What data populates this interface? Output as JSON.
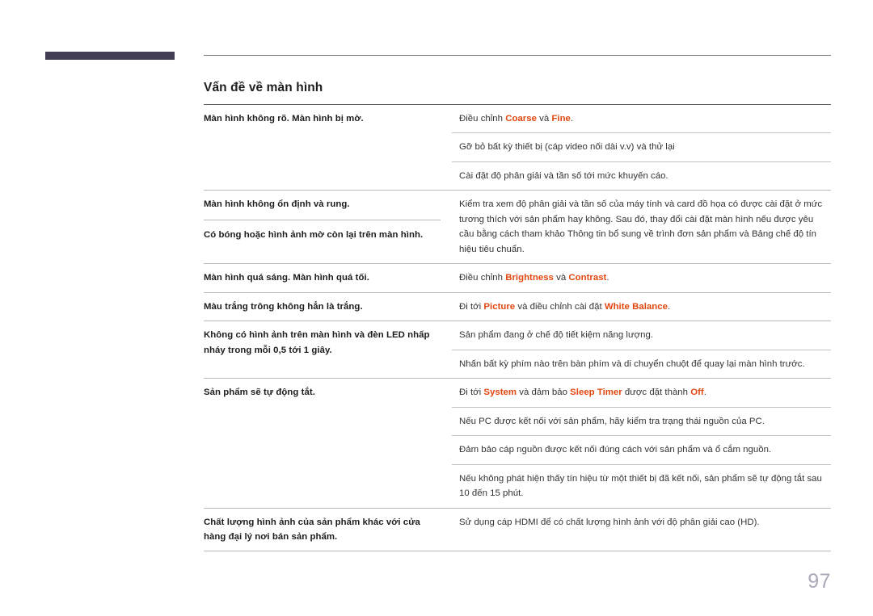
{
  "document": {
    "page_number": "97",
    "heading": "Vấn đề về màn hình",
    "accent_color": "#e2470f",
    "deco_bar_color": "#453d52",
    "page_number_color": "#a9a7b8"
  },
  "table": {
    "rows": [
      {
        "symptom": "Màn hình không rõ. Màn hình bị mờ.",
        "solutions": [
          {
            "parts": [
              {
                "t": "Điều chỉnh ",
                "kw": false
              },
              {
                "t": "Coarse",
                "kw": true
              },
              {
                "t": " và ",
                "kw": false
              },
              {
                "t": "Fine",
                "kw": true
              },
              {
                "t": ".",
                "kw": false
              }
            ]
          },
          {
            "parts": [
              {
                "t": "Gỡ bỏ bất kỳ thiết bị (cáp video nối dài v.v) và thử lại",
                "kw": false
              }
            ]
          },
          {
            "parts": [
              {
                "t": "Cài đặt độ phân giải và tần số tới mức khuyến cáo.",
                "kw": false
              }
            ]
          }
        ]
      },
      {
        "symptom": "Màn hình không ổn định và rung.",
        "symptom2": "Có bóng hoặc hình ảnh mờ còn lại trên màn hình.",
        "solutions": [
          {
            "parts": [
              {
                "t": "Kiểm tra xem độ phân giải và tần số của máy tính và card đồ họa có được cài đặt ở mức tương thích với sản phẩm hay không. Sau đó, thay đổi cài đặt màn hình nếu được yêu cầu bằng cách tham khảo Thông tin bổ sung về trình đơn sản phẩm và Bảng chế độ tín hiệu tiêu chuẩn.",
                "kw": false
              }
            ]
          }
        ]
      },
      {
        "symptom": "Màn hình quá sáng. Màn hình quá tối.",
        "solutions": [
          {
            "parts": [
              {
                "t": "Điều chỉnh ",
                "kw": false
              },
              {
                "t": "Brightness",
                "kw": true
              },
              {
                "t": " và ",
                "kw": false
              },
              {
                "t": "Contrast",
                "kw": true
              },
              {
                "t": ".",
                "kw": false
              }
            ]
          }
        ]
      },
      {
        "symptom": "Màu trắng trông không hẳn là trắng.",
        "solutions": [
          {
            "parts": [
              {
                "t": "Đi tới ",
                "kw": false
              },
              {
                "t": "Picture",
                "kw": true
              },
              {
                "t": " và điều chỉnh cài đặt ",
                "kw": false
              },
              {
                "t": "White Balance",
                "kw": true
              },
              {
                "t": ".",
                "kw": false
              }
            ]
          }
        ]
      },
      {
        "symptom": "Không có hình ảnh trên màn hình và đèn LED nhấp nháy trong mỗi 0,5 tới 1 giây.",
        "solutions": [
          {
            "parts": [
              {
                "t": "Sản phẩm đang ở chế độ tiết kiệm năng lượng.",
                "kw": false
              }
            ]
          },
          {
            "parts": [
              {
                "t": "Nhấn bất kỳ phím nào trên bàn phím và di chuyển chuột để quay lại màn hình trước.",
                "kw": false
              }
            ]
          }
        ]
      },
      {
        "symptom": "Sản phẩm sẽ tự động tắt.",
        "solutions": [
          {
            "parts": [
              {
                "t": "Đi tới ",
                "kw": false
              },
              {
                "t": "System",
                "kw": true
              },
              {
                "t": " và đảm bảo ",
                "kw": false
              },
              {
                "t": "Sleep Timer",
                "kw": true
              },
              {
                "t": " được đặt thành ",
                "kw": false
              },
              {
                "t": "Off",
                "kw": true
              },
              {
                "t": ".",
                "kw": false
              }
            ]
          },
          {
            "parts": [
              {
                "t": "Nếu PC được kết nối với sản phẩm, hãy kiểm tra trạng thái nguồn của PC.",
                "kw": false
              }
            ]
          },
          {
            "parts": [
              {
                "t": "Đảm bảo cáp nguồn được kết nối đúng cách với sản phẩm và ổ cắm nguồn.",
                "kw": false
              }
            ]
          },
          {
            "parts": [
              {
                "t": "Nếu không phát hiện thấy tín hiệu từ một thiết bị đã kết nối, sản phẩm sẽ tự động tắt sau 10 đến 15 phút.",
                "kw": false
              }
            ]
          }
        ]
      },
      {
        "symptom": "Chất lượng hình ảnh của sản phẩm khác với cửa hàng đại lý nơi bán sản phẩm.",
        "solutions": [
          {
            "parts": [
              {
                "t": "Sử dụng cáp HDMI để có chất lượng hình ảnh với độ phân giải cao (HD).",
                "kw": false
              }
            ]
          }
        ]
      }
    ]
  }
}
